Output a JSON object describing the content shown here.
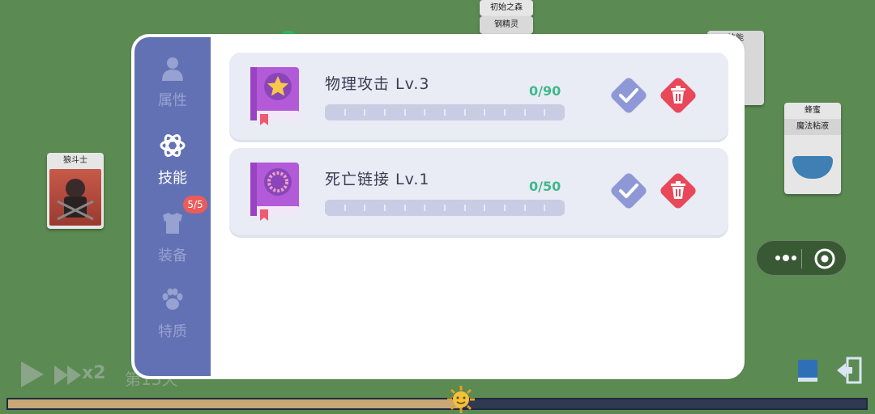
{
  "background": {
    "tag_top": "初始之森",
    "tag_second": "钢精灵",
    "card_left_title": "狼斗士",
    "card_topright_title": "技能",
    "card_right_title": "蜂蜜",
    "card_right_subtitle": "魔法粘液"
  },
  "bottom_bar": {
    "speed_label": "x2",
    "day_label": "第13天",
    "day_progress": 0.53
  },
  "sidebar": {
    "tabs": [
      {
        "label": "属性",
        "icon": "person-icon",
        "active": false
      },
      {
        "label": "技能",
        "icon": "atom-icon",
        "active": true
      },
      {
        "label": "装备",
        "icon": "armor-icon",
        "active": false
      },
      {
        "label": "特质",
        "icon": "paw-icon",
        "active": false
      }
    ],
    "equip_badge": "5/5"
  },
  "skills": [
    {
      "name": "物理攻击 Lv.3",
      "xp": "0/90",
      "xp_fraction": 0.0,
      "icon": "star-book-icon"
    },
    {
      "name": "死亡链接 Lv.1",
      "xp": "0/50",
      "xp_fraction": 0.0,
      "icon": "chain-book-icon"
    }
  ],
  "colors": {
    "accent": "#6271b3",
    "confirm": "#8f98d6",
    "delete": "#e8485a",
    "xp_text": "#3fb98a"
  }
}
